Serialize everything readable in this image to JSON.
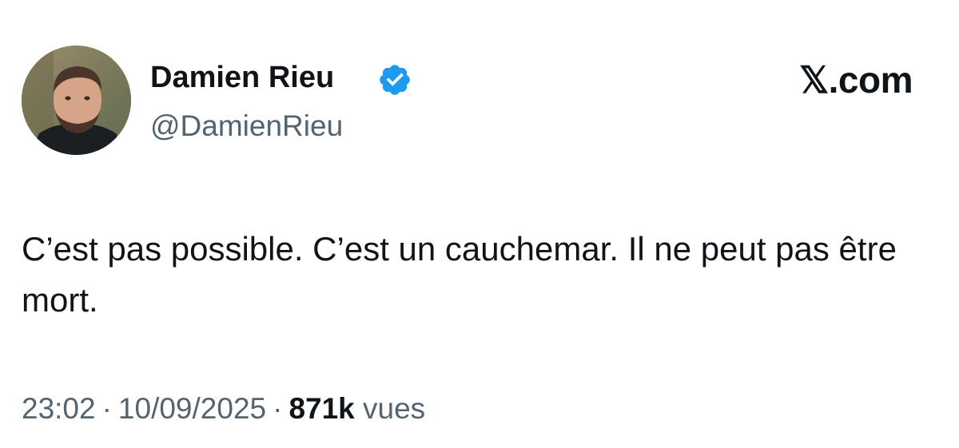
{
  "author": {
    "name": "Damien Rieu",
    "handle": "@DamienRieu",
    "verified": true,
    "verified_color": "#1d9bf0"
  },
  "source": {
    "label": "𝕏.com"
  },
  "tweet": {
    "text": "C’est pas possible. C’est un cauchemar. Il ne peut pas être mort."
  },
  "meta": {
    "time": "23:02",
    "date": "10/09/2025",
    "views_count": "871k",
    "views_label": "vues"
  },
  "icons": {
    "verified": "verified-badge-icon",
    "avatar": "profile-photo"
  }
}
